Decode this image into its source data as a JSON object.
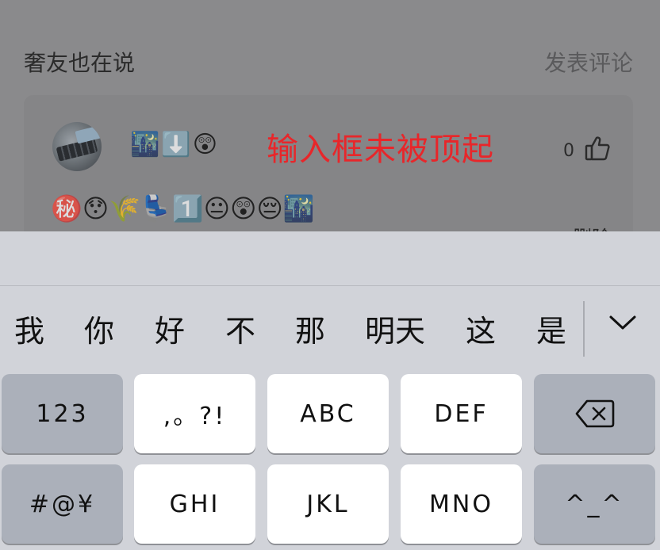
{
  "comments": {
    "section_title": "奢友也在说",
    "post_comment_label": "发表评论",
    "username_emoji": "🌃⬇️😲",
    "annotation": "输入框未被顶起",
    "like_count": "0",
    "comment_text": "㊙️😯🌾💺1️⃣😐😲😔🌃",
    "delete_label": "删除"
  },
  "keyboard": {
    "candidates": [
      "我",
      "你",
      "好",
      "不",
      "那",
      "明天",
      "这",
      "是"
    ],
    "keys": {
      "num": "123",
      "punct": ",。?!",
      "abc": "ABC",
      "def": "DEF",
      "symbols": "#@¥",
      "ghi": "GHI",
      "jkl": "JKL",
      "mno": "MNO",
      "emoticon": "^_^"
    }
  },
  "colors": {
    "annotation": "#e8262a",
    "keyboard_bg": "#d1d3d9",
    "key_light": "#ffffff",
    "key_dark": "#abb0ba"
  },
  "icons": {
    "like": "thumbs-up-icon",
    "collapse": "chevron-down-icon",
    "delete": "backspace-icon"
  }
}
